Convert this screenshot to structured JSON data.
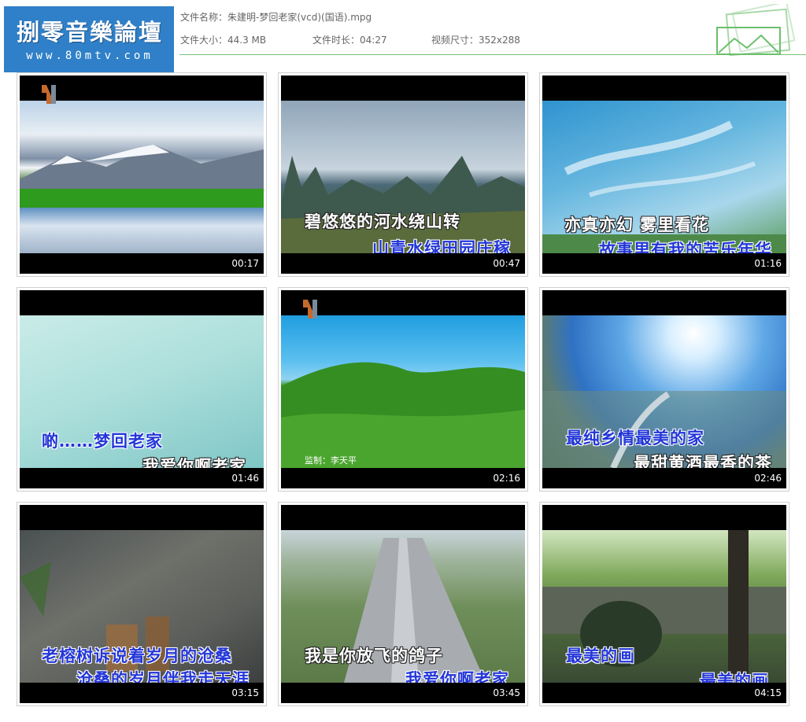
{
  "logo": {
    "title": "捌零音樂論壇",
    "url": "www.80mtv.com"
  },
  "info": {
    "filename_label": "文件名称：",
    "filename": "朱建明-梦回老家(vcd)(国语).mpg",
    "size_label": "文件大小：",
    "size": "44.3 MB",
    "duration_label": "文件时长：",
    "duration": "04:27",
    "dims_label": "视频尺寸：",
    "dims": "352x288"
  },
  "thumbs": [
    {
      "time": "00:17",
      "sub1": "",
      "sub2": "",
      "scene": "snow-mountain-lake"
    },
    {
      "time": "00:47",
      "sub1": "碧悠悠的河水绕山转",
      "sub2": "山青水绿田园庄稼",
      "scene": "karst-hills"
    },
    {
      "time": "01:16",
      "sub1": "亦真亦幻 雾里看花",
      "sub2": "故事里有我的苦乐年华",
      "scene": "blue-sky-clouds"
    },
    {
      "time": "01:46",
      "sub1": "啲……梦回老家",
      "sub2": "我爱你啊老家",
      "scene": "pale-sky"
    },
    {
      "time": "02:16",
      "sub1": "",
      "sub2": "",
      "credit": "监制：李天平",
      "scene": "green-grassland"
    },
    {
      "time": "02:46",
      "sub1": "最纯乡情最美的家",
      "sub2": "最甜黄酒最香的茶",
      "scene": "sunny-town"
    },
    {
      "time": "03:15",
      "sub1": "老榕树诉说着岁月的沧桑",
      "sub2": "沧桑的岁月伴我走天涯",
      "scene": "wood-wall"
    },
    {
      "time": "03:45",
      "sub1": "我是你放飞的鸽子",
      "sub2": "我爱你啊老家",
      "scene": "aerial-road"
    },
    {
      "time": "04:15",
      "sub1": "最美的画",
      "sub2": "最美的画",
      "scene": "stone-bridge-trees"
    }
  ]
}
